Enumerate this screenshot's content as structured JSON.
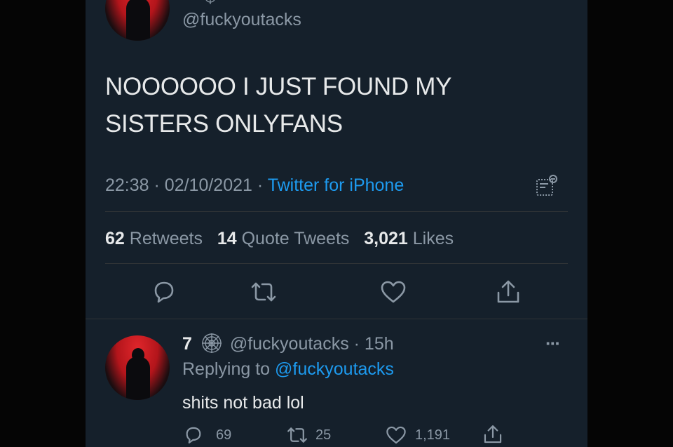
{
  "main_tweet": {
    "handle": "@fuckyoutacks",
    "text_line1": "NOOOOOO I JUST FOUND MY",
    "text_line2": "SISTERS ONLYFANS",
    "time": "22:38",
    "date": "02/10/2021",
    "source": "Twitter for iPhone",
    "separator": "·",
    "stats": {
      "retweets_count": "62",
      "retweets_label": "Retweets",
      "quotes_count": "14",
      "quotes_label": "Quote Tweets",
      "likes_count": "3,021",
      "likes_label": "Likes"
    },
    "actions": [
      "reply-icon",
      "retweet-icon",
      "like-icon",
      "share-icon"
    ]
  },
  "reply_tweet": {
    "name": "7",
    "handle": "@fuckyoutacks",
    "age": "· 15h",
    "replying_prefix": "Replying to",
    "replying_to": "@fuckyoutacks",
    "text": "shits not bad lol",
    "more": "···",
    "reply_count": "69",
    "retweet_count": "25",
    "like_count": "1,191"
  },
  "colors": {
    "background": "#15202b",
    "text": "#e7e9ea",
    "muted": "#8b98a5",
    "link": "#1d9bf0"
  }
}
